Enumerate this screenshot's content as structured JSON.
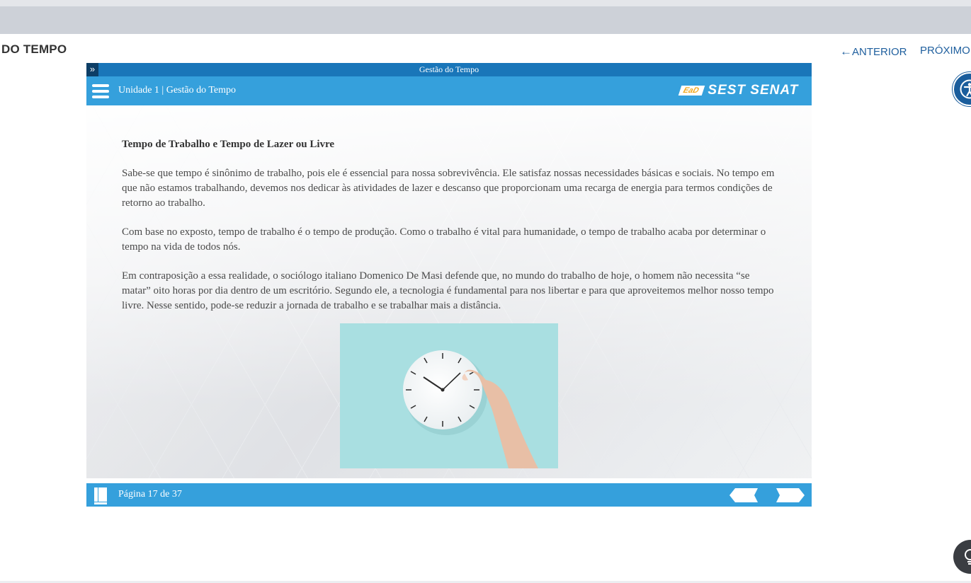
{
  "header": {
    "course_title": "DO TEMPO",
    "prev_label": "ANTERIOR",
    "next_label": "PRÓXIMO"
  },
  "player": {
    "top_title": "Gestão do Tempo",
    "unit_label": "Unidade 1 | Gestão do Tempo",
    "logo": {
      "ead": "EaD",
      "brand": "SEST SENAT"
    },
    "footer": {
      "page_label": "Página 17 de 37"
    },
    "colors": {
      "header": "#35a0dc",
      "topbar": "#1976b9",
      "logo_accent": "#f2a81d"
    }
  },
  "content": {
    "heading": "Tempo de Trabalho e Tempo de Lazer ou Livre",
    "paragraphs": [
      "Sabe-se que tempo é sinônimo de trabalho, pois ele é essencial para nossa sobrevivência. Ele satisfaz nossas necessidades básicas e sociais. No tempo em que não estamos trabalhando, devemos nos dedicar às atividades de lazer e descanso que proporcionam uma recarga de energia para termos condições de retorno ao trabalho.",
      "Com base no exposto, tempo de trabalho é o tempo de produção. Como o trabalho é vital para humanidade, o tempo de trabalho acaba por determinar o tempo na vida de todos nós.",
      "Em contraposição a essa realidade, o sociólogo italiano Domenico De Masi defende que, no mundo do trabalho de hoje, o homem não necessita “se matar” oito horas por dia dentro de um escritório. Segundo ele, a tecnologia é fundamental para nos libertar e para que aproveitemos melhor nosso tempo livre. Nesse sentido, pode-se reduzir a jornada de trabalho e se trabalhar mais a distância."
    ],
    "image_icon": "clock-with-hand-image"
  },
  "icons": {
    "expand": "double-chevron-right-icon",
    "menu": "hamburger-menu-icon",
    "book": "book-icon",
    "accessibility": "accessibility-icon",
    "hint": "lightbulb-icon"
  }
}
